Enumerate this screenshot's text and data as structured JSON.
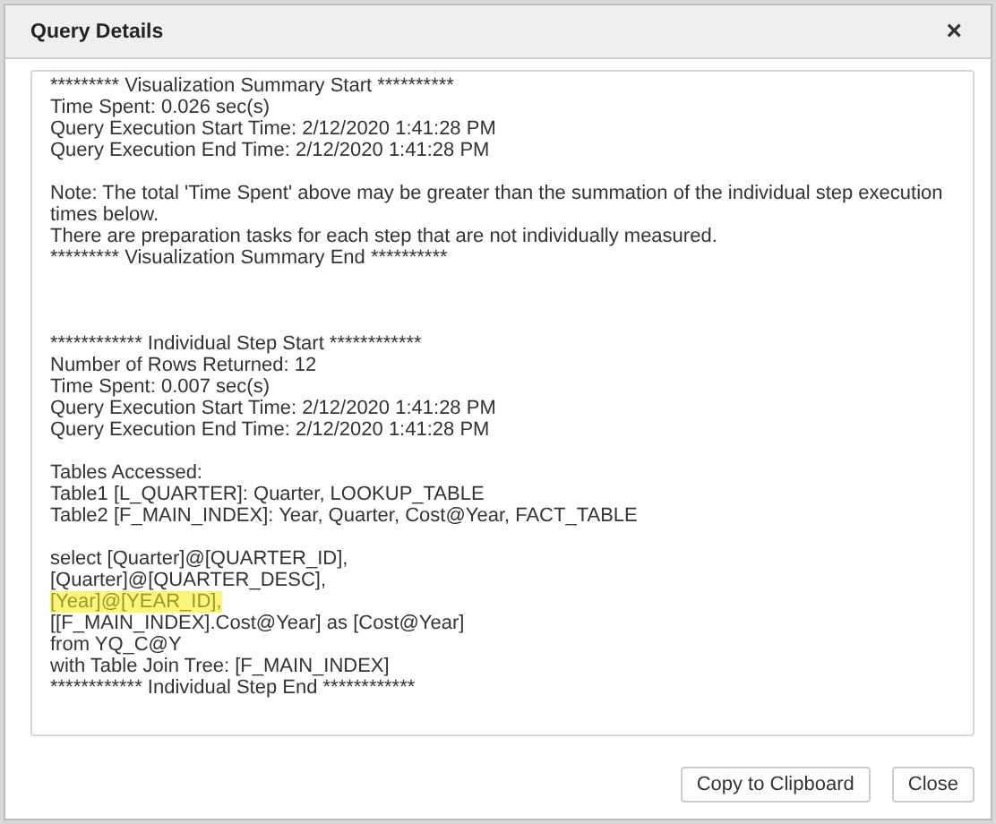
{
  "dialog": {
    "title": "Query Details",
    "close_symbol": "×"
  },
  "details": [
    {
      "wide_gap": false,
      "lines": [
        {
          "text": "********* Visualization Summary Start **********",
          "highlighted": false
        },
        {
          "text": "Time Spent: 0.026 sec(s)",
          "highlighted": false
        },
        {
          "text": "Query Execution Start Time: 2/12/2020 1:41:28 PM",
          "highlighted": false
        },
        {
          "text": "Query Execution End Time: 2/12/2020 1:41:28 PM",
          "highlighted": false
        }
      ]
    },
    {
      "wide_gap": false,
      "lines": [
        {
          "text": "Note: The total 'Time Spent' above may be greater than the summation of the individual step execution times below.",
          "highlighted": false
        },
        {
          "text": "There are preparation tasks for each step that are not individually measured.",
          "highlighted": false
        },
        {
          "text": "********* Visualization Summary End **********",
          "highlighted": false
        }
      ]
    },
    {
      "wide_gap": true,
      "lines": [
        {
          "text": "************ Individual Step Start ************",
          "highlighted": false
        },
        {
          "text": "Number of Rows Returned: 12",
          "highlighted": false
        },
        {
          "text": "Time Spent: 0.007 sec(s)",
          "highlighted": false
        },
        {
          "text": "Query Execution Start Time: 2/12/2020 1:41:28 PM",
          "highlighted": false
        },
        {
          "text": "Query Execution End Time: 2/12/2020 1:41:28 PM",
          "highlighted": false
        }
      ]
    },
    {
      "wide_gap": false,
      "lines": [
        {
          "text": "Tables Accessed:",
          "highlighted": false
        },
        {
          "text": "Table1 [L_QUARTER]: Quarter, LOOKUP_TABLE",
          "highlighted": false
        },
        {
          "text": "Table2 [F_MAIN_INDEX]: Year, Quarter, Cost@Year, FACT_TABLE",
          "highlighted": false
        }
      ]
    },
    {
      "wide_gap": false,
      "lines": [
        {
          "text": "select [Quarter]@[QUARTER_ID],",
          "highlighted": false
        },
        {
          "text": "[Quarter]@[QUARTER_DESC],",
          "highlighted": false
        },
        {
          "text": "[Year]@[YEAR_ID],",
          "highlighted": true
        },
        {
          "text": "[[F_MAIN_INDEX].Cost@Year] as [Cost@Year]",
          "highlighted": false
        },
        {
          "text": "from YQ_C@Y",
          "highlighted": false
        },
        {
          "text": "with Table Join Tree: [F_MAIN_INDEX]",
          "highlighted": false
        },
        {
          "text": "************ Individual Step End ************",
          "highlighted": false
        }
      ]
    }
  ],
  "buttons": [
    "Copy to Clipboard",
    "Close"
  ]
}
